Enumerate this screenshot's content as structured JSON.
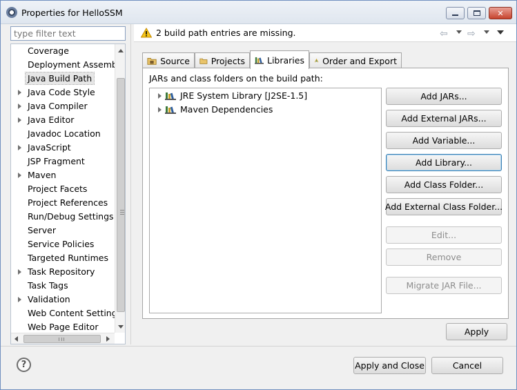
{
  "window": {
    "title": "Properties for HelloSSM"
  },
  "filter": {
    "placeholder": "type filter text"
  },
  "nav": {
    "items": [
      {
        "label": "Coverage",
        "expandable": false
      },
      {
        "label": "Deployment Assembly",
        "expandable": false
      },
      {
        "label": "Java Build Path",
        "expandable": false,
        "selected": true
      },
      {
        "label": "Java Code Style",
        "expandable": true
      },
      {
        "label": "Java Compiler",
        "expandable": true
      },
      {
        "label": "Java Editor",
        "expandable": true
      },
      {
        "label": "Javadoc Location",
        "expandable": false
      },
      {
        "label": "JavaScript",
        "expandable": true
      },
      {
        "label": "JSP Fragment",
        "expandable": false
      },
      {
        "label": "Maven",
        "expandable": true
      },
      {
        "label": "Project Facets",
        "expandable": false
      },
      {
        "label": "Project References",
        "expandable": false
      },
      {
        "label": "Run/Debug Settings",
        "expandable": false
      },
      {
        "label": "Server",
        "expandable": false
      },
      {
        "label": "Service Policies",
        "expandable": false
      },
      {
        "label": "Targeted Runtimes",
        "expandable": false
      },
      {
        "label": "Task Repository",
        "expandable": true
      },
      {
        "label": "Task Tags",
        "expandable": false
      },
      {
        "label": "Validation",
        "expandable": true
      },
      {
        "label": "Web Content Settings",
        "expandable": false
      },
      {
        "label": "Web Page Editor",
        "expandable": false
      }
    ]
  },
  "message": {
    "text": "2 build path entries are missing."
  },
  "tabs": [
    {
      "label": "Source",
      "icon": "source-folder-icon",
      "active": false
    },
    {
      "label": "Projects",
      "icon": "projects-icon",
      "active": false
    },
    {
      "label": "Libraries",
      "icon": "libraries-icon",
      "active": true
    },
    {
      "label": "Order and Export",
      "icon": "order-export-icon",
      "active": false
    }
  ],
  "libraries": {
    "section_label": "JARs and class folders on the build path:",
    "entries": [
      {
        "label": "JRE System Library [J2SE-1.5]",
        "icon": "library-icon"
      },
      {
        "label": "Maven Dependencies",
        "icon": "library-icon"
      }
    ],
    "buttons": [
      {
        "label": "Add JARs...",
        "state": "enabled"
      },
      {
        "label": "Add External JARs...",
        "state": "enabled"
      },
      {
        "label": "Add Variable...",
        "state": "enabled"
      },
      {
        "label": "Add Library...",
        "state": "focused"
      },
      {
        "label": "Add Class Folder...",
        "state": "enabled"
      },
      {
        "label": "Add External Class Folder...",
        "state": "enabled"
      },
      {
        "label": "Edit...",
        "state": "disabled"
      },
      {
        "label": "Remove",
        "state": "disabled"
      },
      {
        "label": "Migrate JAR File...",
        "state": "disabled"
      }
    ]
  },
  "actions": {
    "apply": "Apply",
    "apply_and_close": "Apply and Close",
    "cancel": "Cancel"
  },
  "icons": {
    "help": "?"
  }
}
